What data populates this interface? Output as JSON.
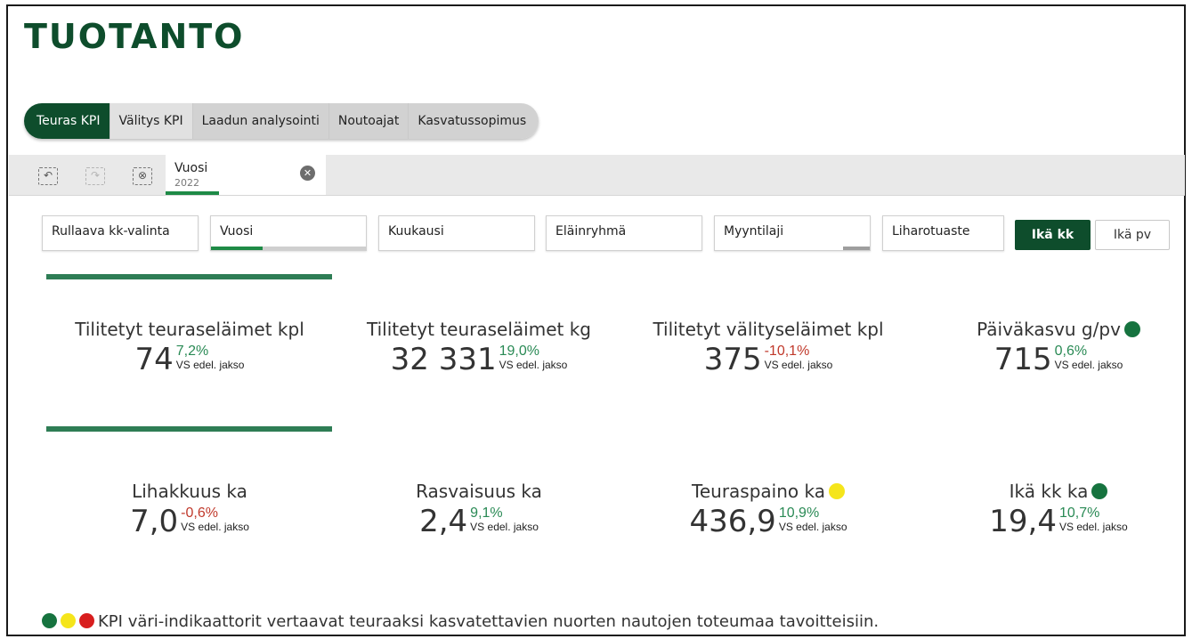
{
  "app_title": "TUOTANTO",
  "tabs": [
    {
      "label": "Teuras KPI",
      "active": true
    },
    {
      "label": "Välitys KPI",
      "active": false
    },
    {
      "label": "Laadun analysointi",
      "active": false
    },
    {
      "label": "Noutoajat",
      "active": false
    },
    {
      "label": "Kasvatussopimus",
      "active": false
    }
  ],
  "selection": {
    "tools": [
      "step-back-icon",
      "step-forward-icon",
      "clear-selections-icon"
    ],
    "chip": {
      "title": "Vuosi",
      "value": "2022",
      "close_icon": "close-circle-icon"
    }
  },
  "filters": [
    {
      "label": "Rullaava kk-valinta"
    },
    {
      "label": "Vuosi",
      "selected_fraction": 0.33
    },
    {
      "label": "Kuukausi"
    },
    {
      "label": "Eläinryhmä"
    },
    {
      "label": "Myyntilaji",
      "selected_fraction": 0.0
    },
    {
      "label": "Liharotuaste"
    }
  ],
  "buttons": {
    "primary": "Ikä kk",
    "secondary": "Ikä pv"
  },
  "kpis_row1": [
    {
      "title": "Tilitetyt teuraseläimet kpl",
      "value": "74",
      "change": "7,2%",
      "trend": "up",
      "vs": "VS edel. jakso"
    },
    {
      "title": "Tilitetyt teuraseläimet kg",
      "value": "32 331",
      "change": "19,0%",
      "trend": "up",
      "vs": "VS edel. jakso"
    },
    {
      "title": "Tilitetyt välityseläimet kpl",
      "value": "375",
      "change": "-10,1%",
      "trend": "down",
      "vs": "VS edel. jakso"
    },
    {
      "title": "Päiväkasvu g/pv",
      "value": "715",
      "change": "0,6%",
      "trend": "up",
      "vs": "VS edel. jakso",
      "indicator": "green"
    }
  ],
  "kpis_row2": [
    {
      "title": "Lihakkuus ka",
      "value": "7,0",
      "change": "-0,6%",
      "trend": "down",
      "vs": "VS edel. jakso"
    },
    {
      "title": "Rasvaisuus ka",
      "value": "2,4",
      "change": "9,1%",
      "trend": "up",
      "vs": "VS edel. jakso"
    },
    {
      "title": "Teuraspaino ka",
      "value": "436,9",
      "change": "10,9%",
      "trend": "up",
      "vs": "VS edel. jakso",
      "indicator": "yellow"
    },
    {
      "title": "Ikä kk ka",
      "value": "19,4",
      "change": "10,7%",
      "trend": "up",
      "vs": "VS edel. jakso",
      "indicator": "green"
    }
  ],
  "legend": {
    "text": "KPI väri-indikaattorit vertaavat teuraaksi kasvatettavien nuorten nautojen toteumaa tavoitteisiin.",
    "dots": [
      "green",
      "yellow",
      "red"
    ]
  },
  "colors": {
    "brand_green": "#0e4d2c",
    "positive": "#2a8a55",
    "negative": "#c0392b",
    "indicator_green": "#16733f",
    "indicator_yellow": "#f5e51b",
    "indicator_red": "#d81e1e",
    "rule": "#2e7d55"
  }
}
